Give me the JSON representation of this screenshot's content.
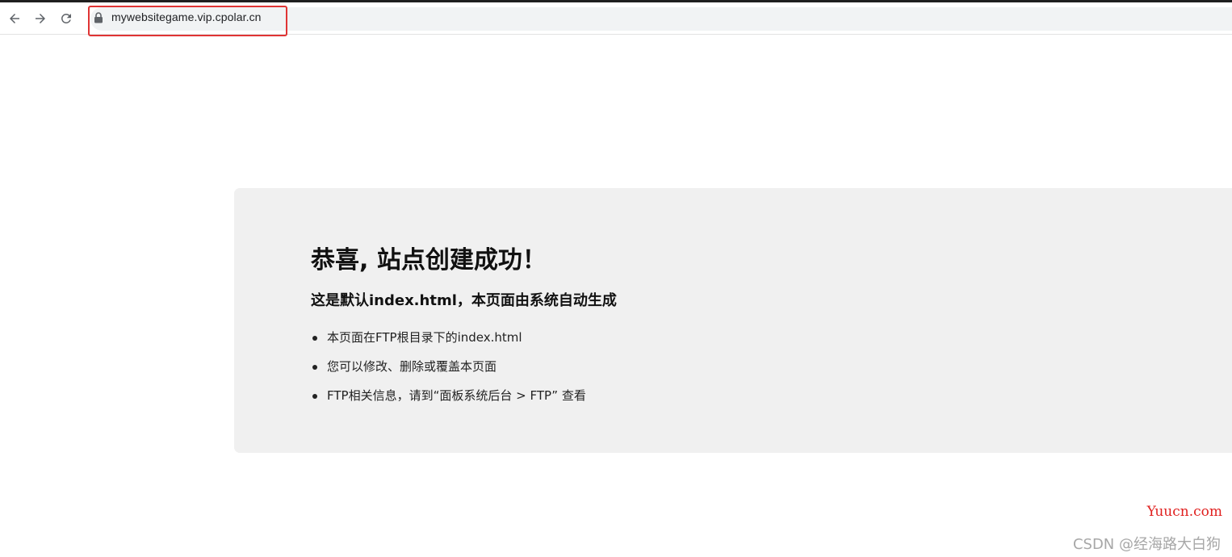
{
  "browser": {
    "url": "mywebsitegame.vip.cpolar.cn",
    "icons": {
      "back": "arrow-left-icon",
      "forward": "arrow-right-icon",
      "reload": "reload-icon",
      "secure": "lock-icon"
    },
    "highlight_color": "#e03434"
  },
  "page": {
    "heading": "恭喜, 站点创建成功！",
    "subheading": "这是默认index.html，本页面由系统自动生成",
    "items": [
      {
        "text": "本页面在FTP根目录下的index.html"
      },
      {
        "text": "您可以修改、删除或覆盖本页面"
      },
      {
        "text": "FTP相关信息，请到“面板系统后台 > FTP” 查看"
      }
    ],
    "card_color": "#f0f0f0"
  },
  "watermarks": {
    "site": "Yuucn.com",
    "author": "CSDN @经海路大白狗"
  }
}
